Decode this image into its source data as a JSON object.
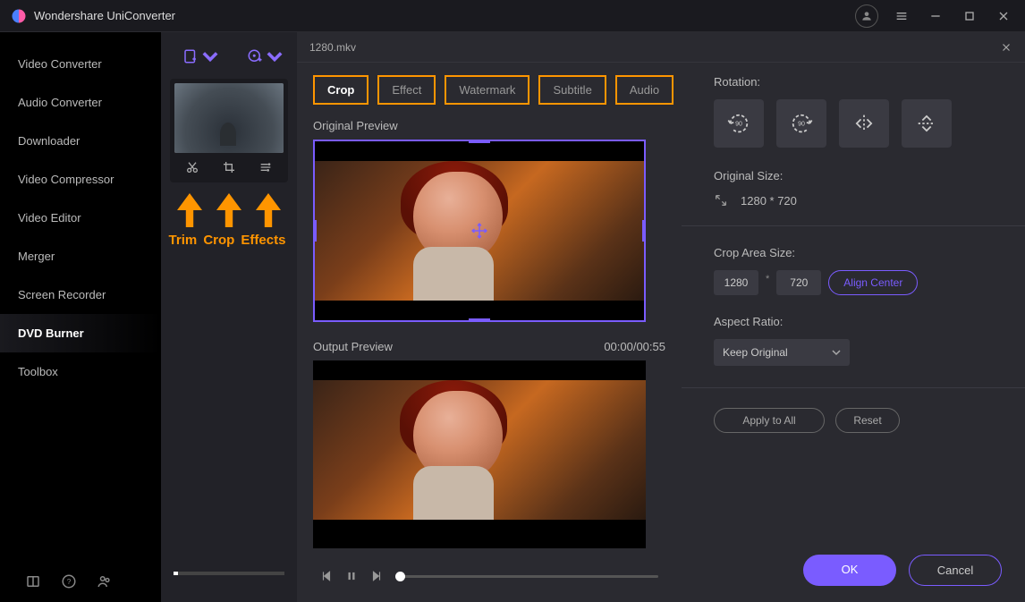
{
  "app_title": "Wondershare UniConverter",
  "sidebar": {
    "items": [
      {
        "label": "Video Converter"
      },
      {
        "label": "Audio Converter"
      },
      {
        "label": "Downloader"
      },
      {
        "label": "Video Compressor"
      },
      {
        "label": "Video Editor"
      },
      {
        "label": "Merger"
      },
      {
        "label": "Screen Recorder"
      },
      {
        "label": "DVD Burner"
      },
      {
        "label": "Toolbox"
      }
    ],
    "active_index": 7
  },
  "annotations": {
    "trim": "Trim",
    "crop": "Crop",
    "effects": "Effects"
  },
  "editor": {
    "filename": "1280.mkv",
    "tabs": [
      {
        "label": "Crop",
        "active": true
      },
      {
        "label": "Effect",
        "active": false
      },
      {
        "label": "Watermark",
        "active": false
      },
      {
        "label": "Subtitle",
        "active": false
      },
      {
        "label": "Audio",
        "active": false
      }
    ],
    "original_label": "Original Preview",
    "output_label": "Output Preview",
    "time_display": "00:00/00:55",
    "rotation_label": "Rotation:",
    "original_size_label": "Original Size:",
    "original_size_value": "1280 * 720",
    "crop_area_label": "Crop Area Size:",
    "crop_width": "1280",
    "crop_height": "720",
    "align_center": "Align Center",
    "aspect_label": "Aspect Ratio:",
    "aspect_value": "Keep Original",
    "apply_all": "Apply to All",
    "reset": "Reset",
    "ok": "OK",
    "cancel": "Cancel"
  }
}
